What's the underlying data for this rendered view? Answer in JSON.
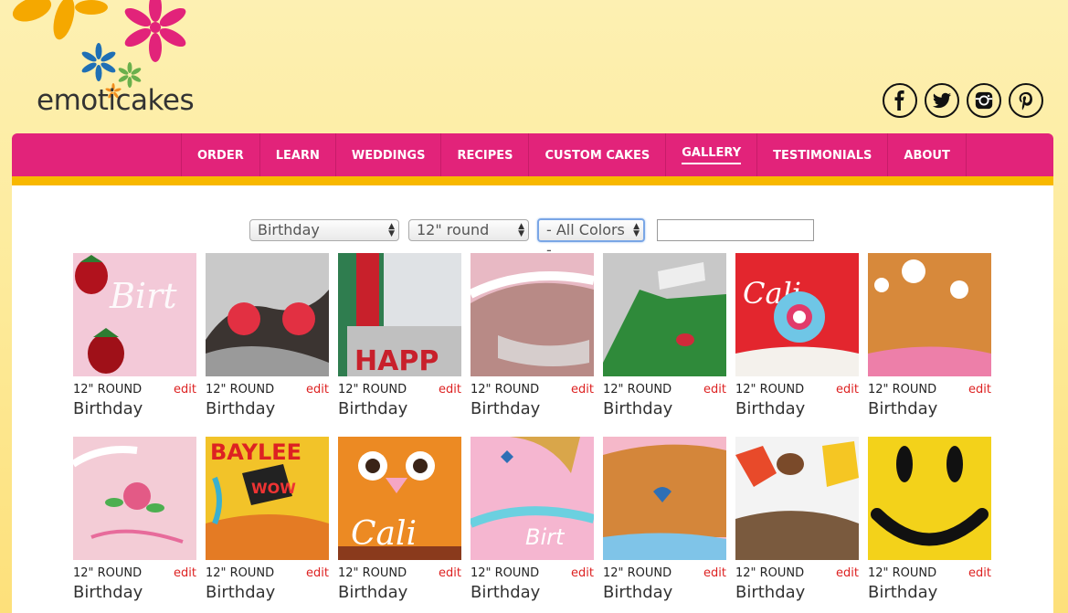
{
  "brand": {
    "name": "emoticakes"
  },
  "social": [
    {
      "name": "facebook-icon"
    },
    {
      "name": "twitter-icon"
    },
    {
      "name": "instagram-icon"
    },
    {
      "name": "pinterest-icon"
    }
  ],
  "nav": {
    "items": [
      {
        "label": "ORDER"
      },
      {
        "label": "LEARN"
      },
      {
        "label": "WEDDINGS"
      },
      {
        "label": "RECIPES"
      },
      {
        "label": "CUSTOM CAKES"
      },
      {
        "label": "GALLERY",
        "active": true
      },
      {
        "label": "TESTIMONIALS"
      },
      {
        "label": "ABOUT"
      }
    ]
  },
  "filters": {
    "occasion": "Birthday",
    "size": "12\" round",
    "color": "- All Colors -",
    "search_value": ""
  },
  "gallery": {
    "edit_label": "edit",
    "items": [
      {
        "size": "12\" ROUND",
        "category": "Birthday"
      },
      {
        "size": "12\" ROUND",
        "category": "Birthday"
      },
      {
        "size": "12\" ROUND",
        "category": "Birthday"
      },
      {
        "size": "12\" ROUND",
        "category": "Birthday"
      },
      {
        "size": "12\" ROUND",
        "category": "Birthday"
      },
      {
        "size": "12\" ROUND",
        "category": "Birthday"
      },
      {
        "size": "12\" ROUND",
        "category": "Birthday"
      },
      {
        "size": "12\" ROUND",
        "category": "Birthday"
      },
      {
        "size": "12\" ROUND",
        "category": "Birthday"
      },
      {
        "size": "12\" ROUND",
        "category": "Birthday"
      },
      {
        "size": "12\" ROUND",
        "category": "Birthday"
      },
      {
        "size": "12\" ROUND",
        "category": "Birthday"
      },
      {
        "size": "12\" ROUND",
        "category": "Birthday"
      },
      {
        "size": "12\" ROUND",
        "category": "Birthday"
      }
    ]
  },
  "colors": {
    "nav_bg": "#e2237a",
    "nav_stripe": "#f8b800",
    "edit_link": "#d22222"
  }
}
